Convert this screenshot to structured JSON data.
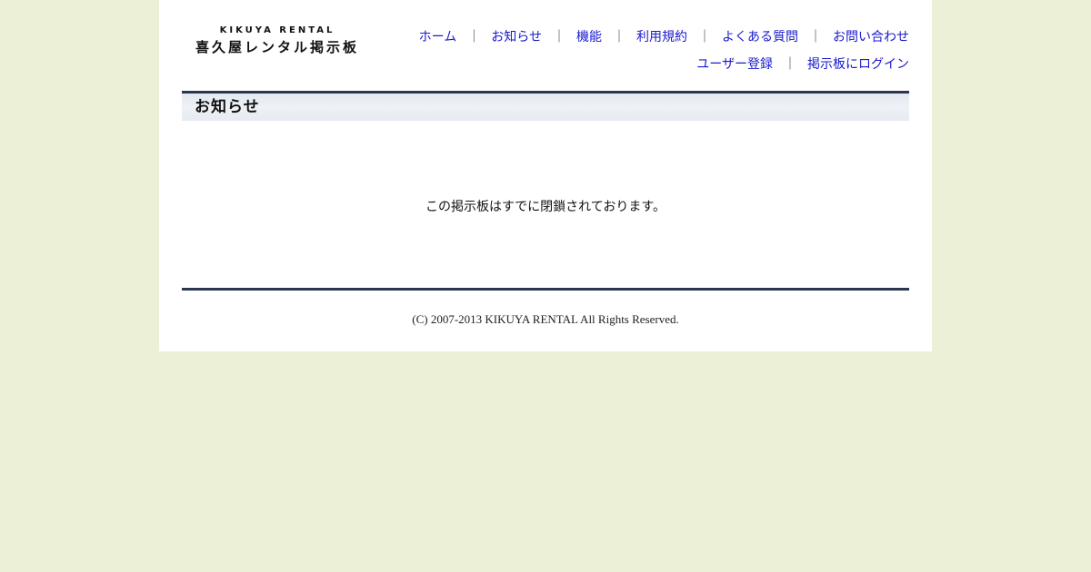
{
  "logo": {
    "en": "KIKUYA RENTAL",
    "ja": "喜久屋レンタル掲示板"
  },
  "nav": {
    "row1": [
      {
        "label": "ホーム"
      },
      {
        "label": "お知らせ"
      },
      {
        "label": "機能"
      },
      {
        "label": "利用規約"
      },
      {
        "label": "よくある質問"
      },
      {
        "label": "お問い合わせ"
      }
    ],
    "row2": [
      {
        "label": "ユーザー登録"
      },
      {
        "label": "掲示板にログイン"
      }
    ],
    "separator": "｜"
  },
  "section": {
    "title": "お知らせ"
  },
  "main": {
    "message": "この掲示板はすでに閉鎖されております。"
  },
  "footer": {
    "copyright": "(C) 2007-2013 KIKUYA RENTAL All Rights Reserved."
  },
  "colors": {
    "background": "#ecf0d6",
    "link": "#1a1acc",
    "rule": "#2b3650"
  }
}
